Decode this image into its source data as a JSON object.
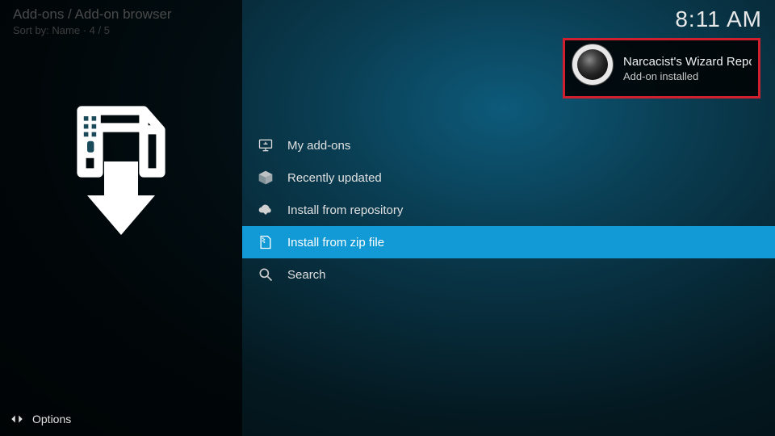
{
  "header": {
    "breadcrumb": "Add-ons / Add-on browser",
    "sort_label": "Sort by: Name  ·  4 / 5",
    "clock": "8:11 AM"
  },
  "menu": {
    "items": [
      {
        "label": "My add-ons",
        "icon": "monitor-icon",
        "selected": false
      },
      {
        "label": "Recently updated",
        "icon": "box-open-icon",
        "selected": false
      },
      {
        "label": "Install from repository",
        "icon": "cloud-download-icon",
        "selected": false
      },
      {
        "label": "Install from zip file",
        "icon": "zip-file-icon",
        "selected": true
      },
      {
        "label": "Search",
        "icon": "search-icon",
        "selected": false
      }
    ]
  },
  "footer": {
    "options_label": "Options"
  },
  "notification": {
    "title": "Narcacist's Wizard Repositc",
    "subtitle": "Add-on installed"
  }
}
